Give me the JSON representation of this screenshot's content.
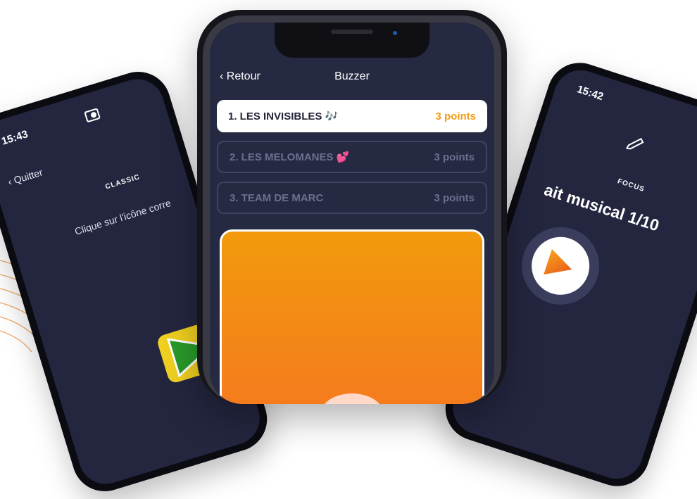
{
  "left_phone": {
    "time": "15:43",
    "back_label": "Quitter",
    "mode_label": "CLASSIC",
    "instruction": "Clique sur l'icône corre"
  },
  "center_phone": {
    "back_label": "Retour",
    "title": "Buzzer",
    "teams": [
      {
        "label": "1. LES INVISIBLES 🎶",
        "points": "3 points"
      },
      {
        "label": "2. LES MELOMANES 💕",
        "points": "3 points"
      },
      {
        "label": "3. TEAM DE MARC",
        "points": "3 points"
      }
    ]
  },
  "right_phone": {
    "time": "15:42",
    "mode_label": "FOCUS",
    "title": "ait musical 1/10"
  },
  "colors": {
    "screen_bg": "#242640",
    "accent_orange": "#f39c12",
    "active_row": "#ffffff"
  }
}
